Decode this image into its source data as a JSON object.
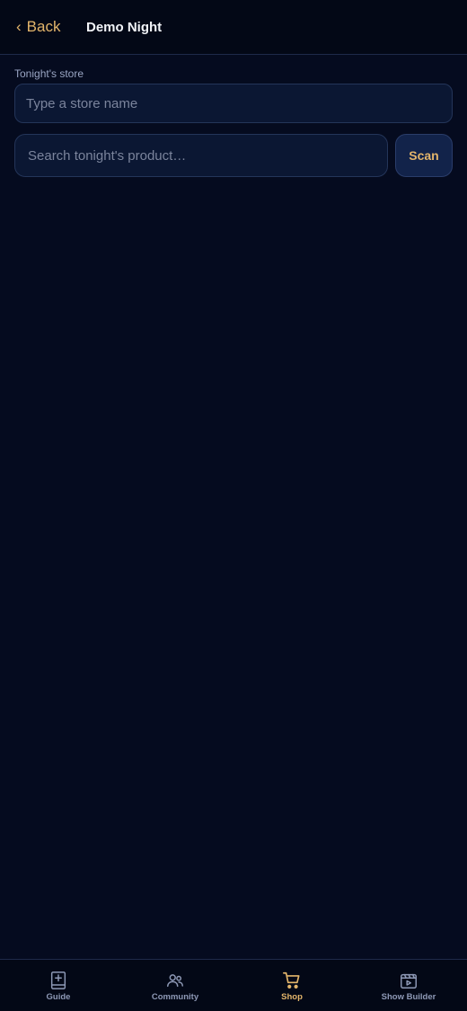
{
  "header": {
    "back_label": "Back",
    "title": "Demo Night"
  },
  "store": {
    "label": "Tonight's store",
    "placeholder": "Type a store name",
    "value": ""
  },
  "search": {
    "placeholder": "Search tonight's product…",
    "value": "",
    "scan_label": "Scan"
  },
  "tabs": [
    {
      "label": "Guide",
      "icon": "book-plus-icon",
      "active": false
    },
    {
      "label": "Community",
      "icon": "people-icon",
      "active": false
    },
    {
      "label": "Shop",
      "icon": "cart-icon",
      "active": true
    },
    {
      "label": "Show Builder",
      "icon": "clapperboard-icon",
      "active": false
    }
  ],
  "colors": {
    "background": "#050b1f",
    "accent": "#e3b56b",
    "inactive": "#8e99b6"
  }
}
